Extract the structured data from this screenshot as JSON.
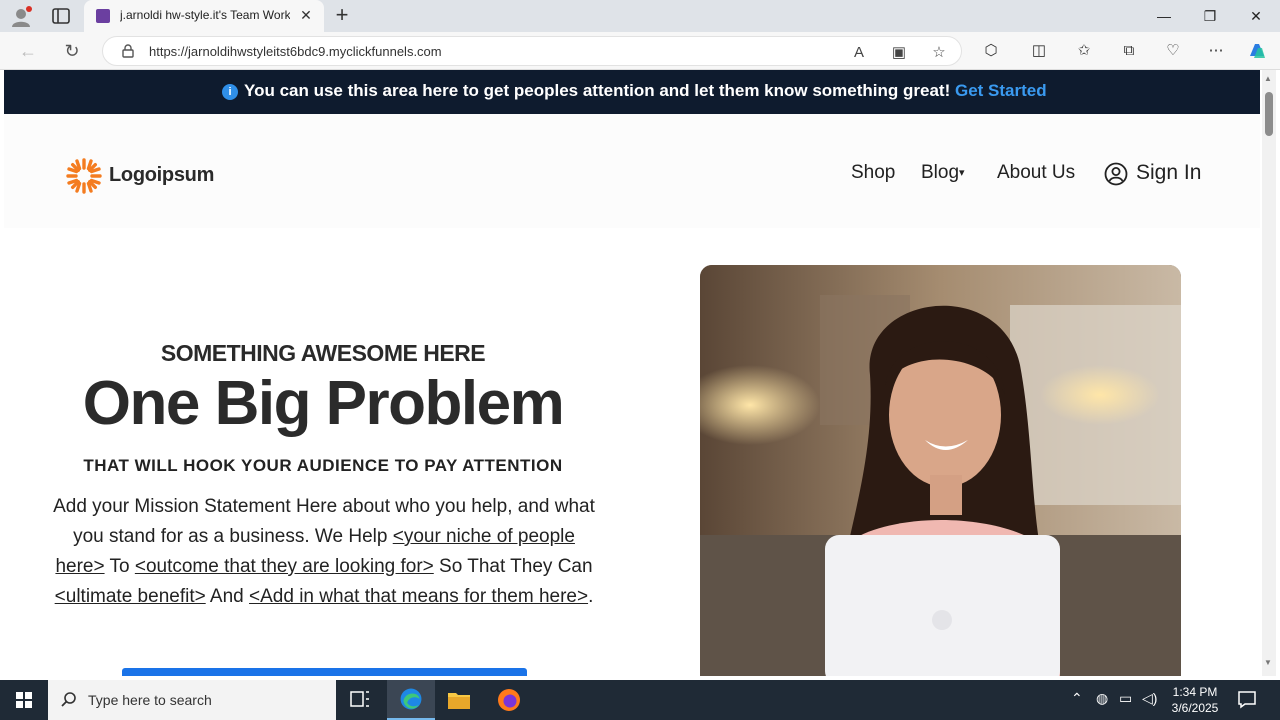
{
  "browser": {
    "tab_title": "j.arnoldi hw-style.it's Team Work",
    "url": "https://jarnoldihwstyleitst6bdc9.myclickfunnels.com",
    "new_tab_glyph": "+",
    "tab_close_glyph": "✕",
    "minimize_glyph": "—",
    "maximize_glyph": "❐",
    "close_glyph": "✕"
  },
  "announcement": {
    "text": "You can use this area here to get peoples attention and let them know something great!",
    "cta": "Get Started",
    "info_glyph": "i"
  },
  "header": {
    "logo_text": "Logoipsum",
    "nav": [
      "Shop",
      "Blog",
      "About Us"
    ],
    "blog_caret": "▾",
    "sign_in": "Sign In"
  },
  "hero": {
    "eyebrow": "SOMETHING AWESOME HERE",
    "headline": "One Big Problem",
    "subhead": "THAT WILL HOOK YOUR AUDIENCE TO PAY ATTENTION",
    "mission_1": "Add your Mission Statement Here about who you help, and what you stand for as a business. We Help ",
    "mission_link_1": "<your niche of people here>",
    "mission_2": " To ",
    "mission_link_2": "<outcome that they are looking for>",
    "mission_3": " So That They Can ",
    "mission_link_3": "<ultimate benefit>",
    "mission_4": " And ",
    "mission_link_4": "<Add in what that means for them here>",
    "mission_5": "."
  },
  "taskbar": {
    "search_placeholder": "Type here to search",
    "time": "1:34 PM",
    "date": "3/6/2025"
  },
  "colors": {
    "announce_bg": "#0e1b2e",
    "announce_cta": "#3a9af0",
    "cta_blue": "#1a73e8",
    "logo_orange": "#f47c20"
  }
}
